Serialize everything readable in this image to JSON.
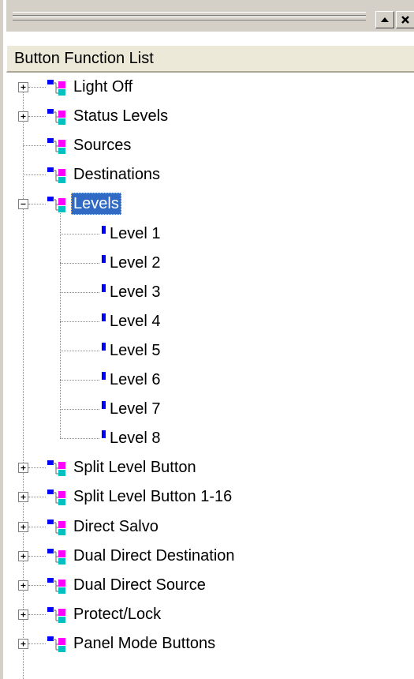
{
  "toolbar": {
    "scroll_up_icon": "triangle-up-icon",
    "close_icon": "x-icon"
  },
  "header": {
    "title": "Button Function List"
  },
  "colors": {
    "selection": "#316ac5",
    "icon_blue": "#0000ff",
    "icon_magenta": "#ff00ff",
    "icon_cyan": "#00c0c0",
    "chrome": "#d4d0c8",
    "header_bg": "#ece9d8"
  },
  "tree": {
    "items_before": [
      {
        "label": "Light Off",
        "expandable": true
      },
      {
        "label": "Status Levels",
        "expandable": true
      },
      {
        "label": "Sources",
        "expandable": false
      },
      {
        "label": "Destinations",
        "expandable": false
      }
    ],
    "expanded_item": {
      "label": "Levels",
      "expanded": true,
      "selected": true
    },
    "children": [
      {
        "label": "Level 1"
      },
      {
        "label": "Level 2"
      },
      {
        "label": "Level 3"
      },
      {
        "label": "Level 4"
      },
      {
        "label": "Level 5"
      },
      {
        "label": "Level 6"
      },
      {
        "label": "Level 7"
      },
      {
        "label": "Level 8"
      }
    ],
    "items_after": [
      {
        "label": "Split Level Button",
        "expandable": true
      },
      {
        "label": "Split Level Button 1-16",
        "expandable": true
      },
      {
        "label": "Direct Salvo",
        "expandable": true
      },
      {
        "label": "Dual Direct Destination",
        "expandable": true
      },
      {
        "label": "Dual Direct Source",
        "expandable": true
      },
      {
        "label": "Protect/Lock",
        "expandable": true
      },
      {
        "label": "Panel Mode Buttons",
        "expandable": true
      }
    ]
  }
}
